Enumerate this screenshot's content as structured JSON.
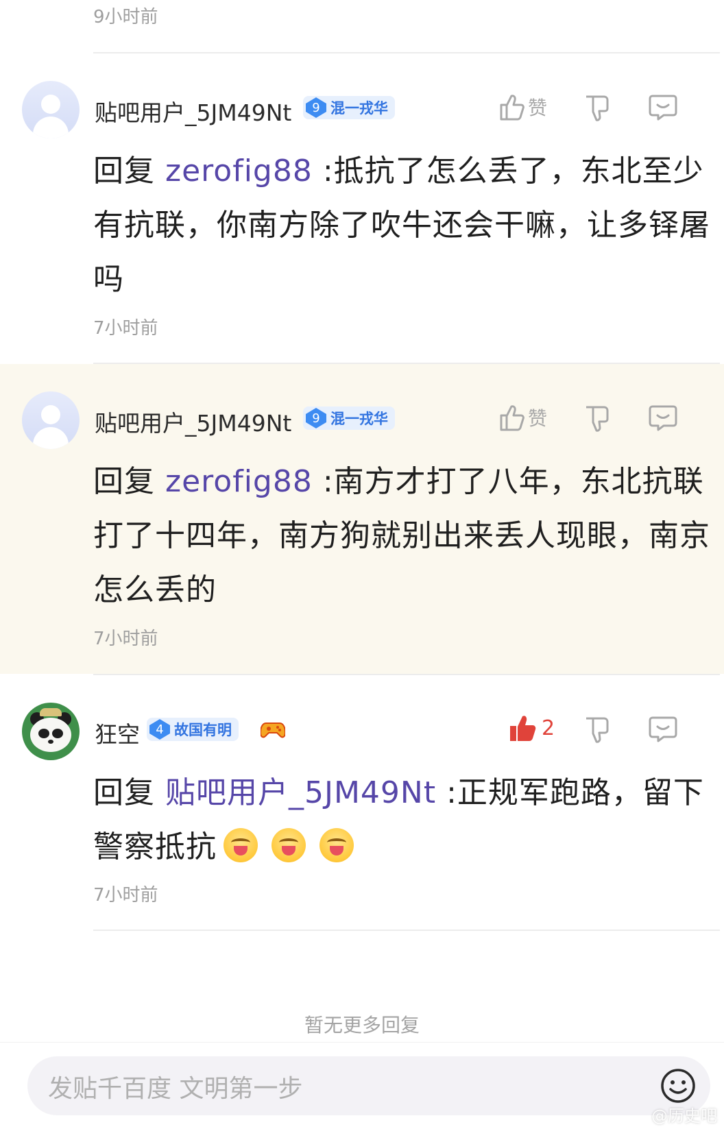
{
  "top_time": "9小时前",
  "comments": [
    {
      "username": "贴吧用户_5JM49Nt",
      "level": "9",
      "badge": "混一戎华",
      "like_label": "赞",
      "reply_prefix": "回复 ",
      "mention": "zerofig88",
      "text": " :抵抗了怎么丢了，东北至少有抗联，你南方除了吹牛还会干嘛，让多铎屠吗",
      "time": "7小时前"
    },
    {
      "username": "贴吧用户_5JM49Nt",
      "level": "9",
      "badge": "混一戎华",
      "like_label": "赞",
      "reply_prefix": "回复 ",
      "mention": "zerofig88",
      "text": " :南方才打了八年，东北抗联打了十四年，南方狗就别出来丢人现眼，南京怎么丢的",
      "time": "7小时前",
      "highlighted": true
    },
    {
      "username": "狂空",
      "level": "4",
      "badge": "故国有明",
      "like_count": "2",
      "liked": true,
      "reply_prefix": "回复 ",
      "mention": "贴吧用户_5JM49Nt",
      "text": " :正规军跑路，留下警察抵抗",
      "emoji_count": 3,
      "time": "7小时前"
    }
  ],
  "no_more": "暂无更多回复",
  "input_placeholder": "发贴千百度 文明第一步",
  "watermark": "@历史吧",
  "colors": {
    "mention": "#5646a8",
    "badge_text": "#3274e0",
    "like_active": "#e0433a",
    "highlight_bg": "#fbf8ee"
  }
}
